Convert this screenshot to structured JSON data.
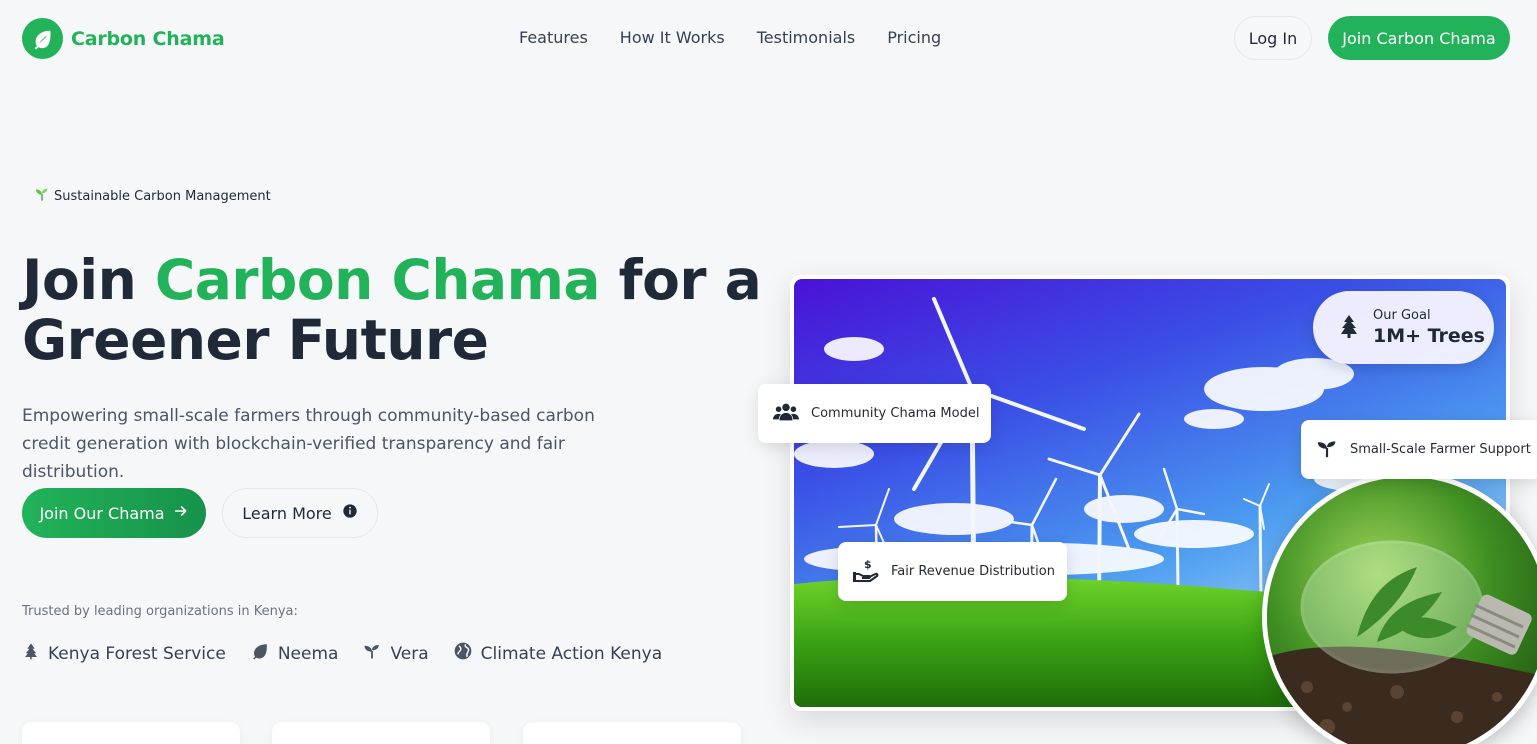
{
  "brand": {
    "name": "Carbon Chama",
    "color": "#22b35a",
    "logo_icon": "leaf-icon"
  },
  "nav": {
    "links": [
      "Features",
      "How It Works",
      "Testimonials",
      "Pricing"
    ],
    "login_label": "Log In",
    "join_label": "Join Carbon Chama"
  },
  "hero": {
    "tagline_icon": "seedling-icon",
    "tagline": "Sustainable Carbon Management",
    "headline_part1": "Join ",
    "headline_highlight": "Carbon Chama",
    "headline_part2": " for a Greener Future",
    "subtext": "Empowering small-scale farmers through community-based carbon credit generation with blockchain-verified transparency and fair distribution.",
    "primary_button": "Join Our Chama",
    "primary_icon": "arrow-right-icon",
    "secondary_button": "Learn More",
    "secondary_icon": "info-icon",
    "trusted_label": "Trusted by leading organizations in Kenya:",
    "trusted": [
      {
        "icon": "tree-icon",
        "name": "Kenya Forest Service"
      },
      {
        "icon": "leaf-icon",
        "name": "Neema"
      },
      {
        "icon": "seedling-icon",
        "name": "Vera"
      },
      {
        "icon": "globe-icon",
        "name": "Climate Action Kenya"
      }
    ]
  },
  "image_panel": {
    "goal_label": "Our Goal",
    "goal_value": "1M+ Trees",
    "goal_icon": "tree-icon",
    "features": [
      {
        "icon": "users-icon",
        "label": "Community Chama Model"
      },
      {
        "icon": "seedling-icon",
        "label": "Small-Scale Farmer Support"
      },
      {
        "icon": "hand-dollar-icon",
        "label": "Fair Revenue Distribution"
      }
    ]
  }
}
